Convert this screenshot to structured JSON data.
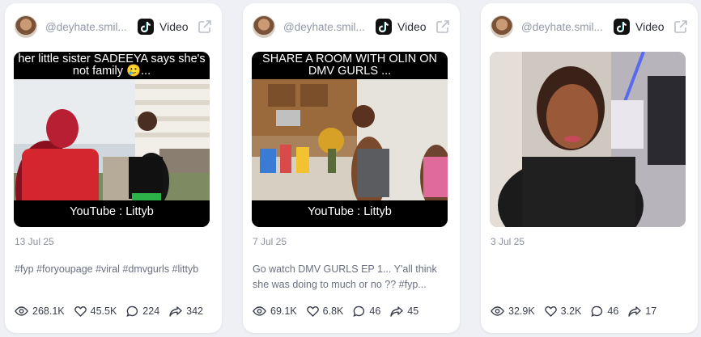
{
  "cards": [
    {
      "handle": "@deyhate.smil...",
      "media_type": "Video",
      "platform_icon": "tiktok-icon",
      "caption_top": "her little sister SADEEYA says she's not family 🥲...",
      "caption_bottom": "YouTube : Littyb",
      "date": "13 Jul 25",
      "description": "#fyp #foryoupage #viral #dmvgurls #littyb",
      "stats": {
        "views": "268.1K",
        "likes": "45.5K",
        "comments": "224",
        "shares": "342"
      }
    },
    {
      "handle": "@deyhate.smil...",
      "media_type": "Video",
      "platform_icon": "tiktok-icon",
      "caption_top": "SHARE A ROOM WITH OLIN ON DMV GURLS ...",
      "caption_bottom": "YouTube : Littyb",
      "date": "7 Jul 25",
      "description": "Go watch DMV GURLS EP 1... Y'all think she was doing to much or no ?? #fyp...",
      "stats": {
        "views": "69.1K",
        "likes": "6.8K",
        "comments": "46",
        "shares": "45"
      }
    },
    {
      "handle": "@deyhate.smil...",
      "media_type": "Video",
      "platform_icon": "tiktok-icon",
      "caption_top": "",
      "caption_bottom": "",
      "date": "3 Jul 25",
      "description": "",
      "stats": {
        "views": "32.9K",
        "likes": "3.2K",
        "comments": "46",
        "shares": "17"
      }
    }
  ],
  "colors": {
    "card_bg": "#ffffff",
    "page_bg": "#eef0f5",
    "muted_text": "#8b91a0",
    "caption_bg": "#000000"
  }
}
